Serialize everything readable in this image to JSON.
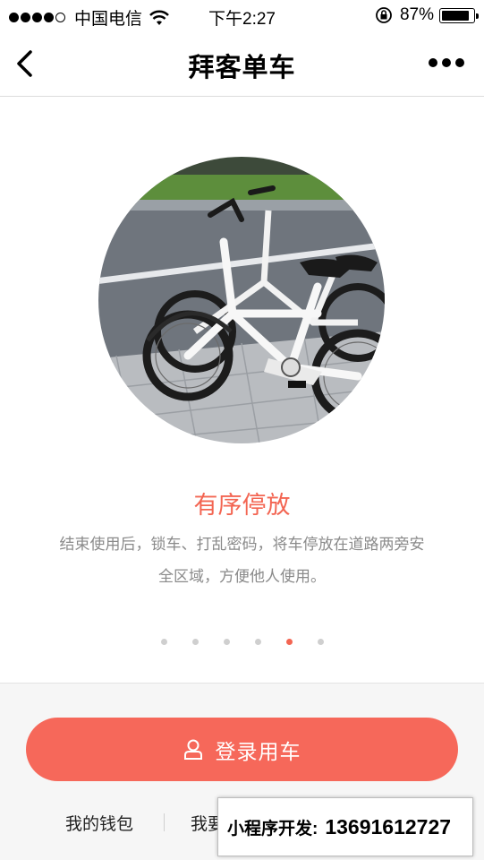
{
  "status_bar": {
    "carrier": "中国电信",
    "time": "下午2:27",
    "battery_percent": "87%",
    "battery_level": 0.87,
    "signal_bars": 4
  },
  "nav": {
    "title": "拜客单车",
    "back_icon": "chevron-left-icon",
    "more_icon": "more-dots-icon"
  },
  "feature": {
    "title": "有序停放",
    "description": "结束使用后，锁车、打乱密码，将车停放在道路两旁安全区域，方便他人使用。",
    "page_count": 6,
    "active_page": 5
  },
  "actions": {
    "login_label": "登录用车",
    "wallet_label": "我的钱包",
    "second_label": "我要"
  },
  "promo": {
    "label": "小程序开发:",
    "number": "13691612727"
  },
  "colors": {
    "accent": "#f6685a",
    "title_accent": "#f36552"
  }
}
